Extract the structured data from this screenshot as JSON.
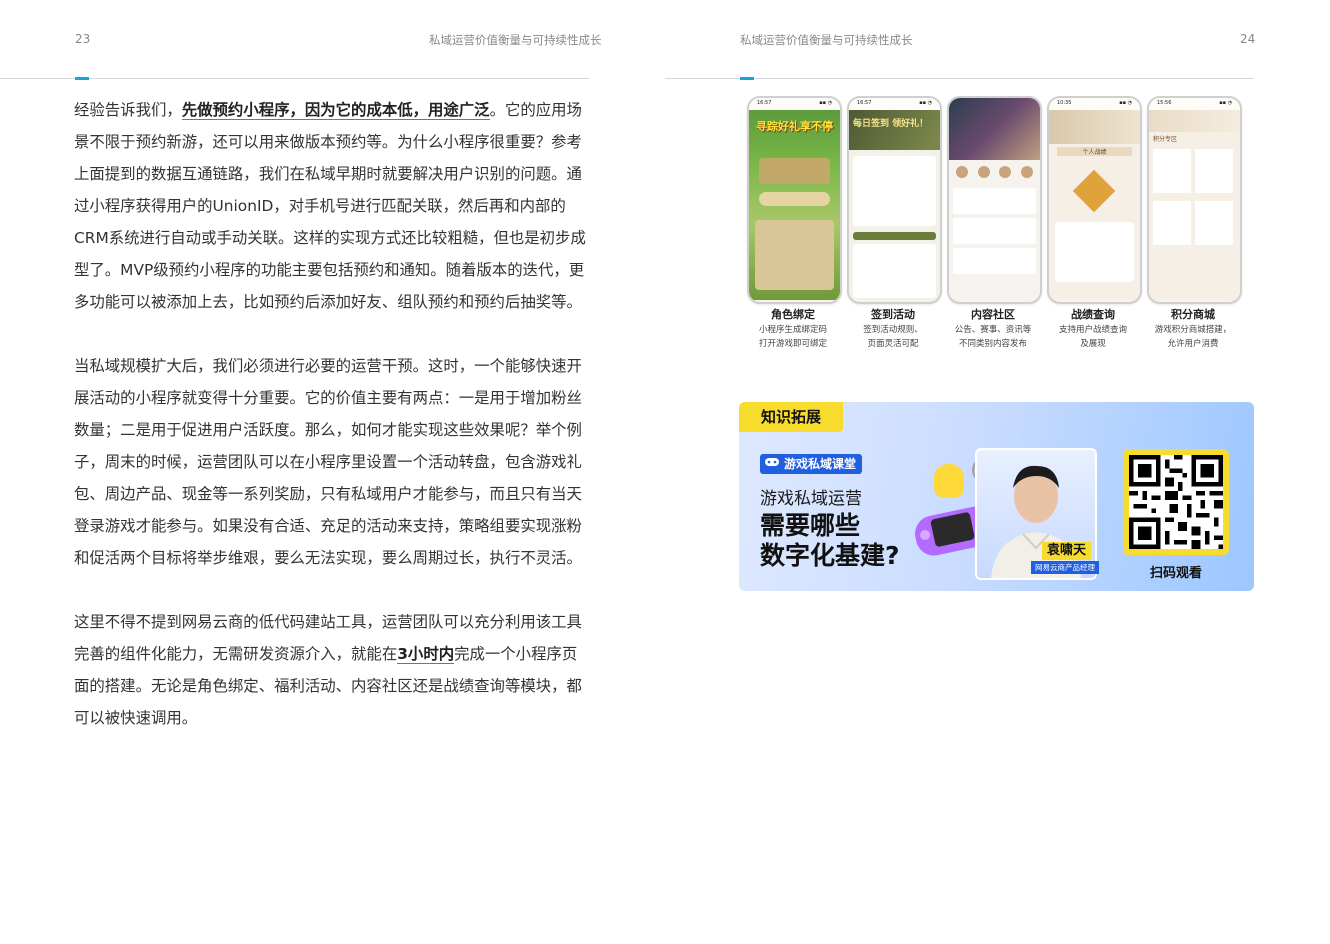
{
  "left_page": {
    "page_number": "23",
    "running_title": "私域运营价值衡量与可持续性成长",
    "para1": {
      "pre": "经验告诉我们，",
      "highlight": "先做预约小程序，因为它的成本低，用途广泛",
      "post": "。它的应用场景不限于预约新游，还可以用来做版本预约等。为什么小程序很重要？参考上面提到的数据互通链路，我们在私域早期时就要解决用户识别的问题。通过小程序获得用户的UnionID，对手机号进行匹配关联，然后再和内部的CRM系统进行自动或手动关联。这样的实现方式还比较粗糙，但也是初步成型了。MVP级预约小程序的功能主要包括预约和通知。随着版本的迭代，更多功能可以被添加上去，比如预约后添加好友、组队预约和预约后抽奖等。"
    },
    "para2": "当私域规模扩大后，我们必须进行必要的运营干预。这时，一个能够快速开展活动的小程序就变得十分重要。它的价值主要有两点：一是用于增加粉丝数量；二是用于促进用户活跃度。那么，如何才能实现这些效果呢？举个例子，周末的时候，运营团队可以在小程序里设置一个活动转盘，包含游戏礼包、周边产品、现金等一系列奖励，只有私域用户才能参与，而且只有当天登录游戏才能参与。如果没有合适、充足的活动来支持，策略组要实现涨粉和促活两个目标将举步维艰，要么无法实现，要么周期过长，执行不灵活。",
    "para3": {
      "pre": "这里不得不提到网易云商的低代码建站工具，运营团队可以充分利用该工具完善的组件化能力，无需研发资源介入，就能在",
      "highlight": "3小时内",
      "post": "完成一个小程序页面的搭建。无论是角色绑定、福利活动、内容社区还是战绩查询等模块，都可以被快速调用。"
    }
  },
  "right_page": {
    "page_number": "24",
    "running_title": "私域运营价值衡量与可持续性成长",
    "phones": [
      {
        "title": "角色绑定",
        "desc1": "小程序生成绑定码",
        "desc2": "打开游戏即可绑定",
        "screen_text": "寻踪好礼享不停",
        "time": "16:57"
      },
      {
        "title": "签到活动",
        "desc1": "签到活动规则、",
        "desc2": "页面灵活可配",
        "screen_text": "每日签到 领好礼！",
        "time": "16:57"
      },
      {
        "title": "内容社区",
        "desc1": "公告、赛事、资讯等",
        "desc2": "不同类别内容发布",
        "screen_text": "",
        "time": "10:35"
      },
      {
        "title": "战绩查询",
        "desc1": "支持用户战绩查询",
        "desc2": "及展现",
        "screen_text": "个人战绩",
        "time": "10:35"
      },
      {
        "title": "积分商城",
        "desc1": "游戏积分商城搭建，",
        "desc2": "允许用户消费",
        "screen_text": "积分专区",
        "time": "15:56"
      }
    ],
    "banner": {
      "tag": "知识拓展",
      "badge": "游戏私域课堂",
      "line1": "游戏私域运营",
      "line2": "需要哪些",
      "line3": "数字化基建?",
      "person_name": "袁啸天",
      "person_role": "网易云商产品经理",
      "qr_label": "扫码观看"
    }
  },
  "colors": {
    "accent_blue": "#14a6d8",
    "tag_yellow": "#f7dc2e",
    "badge_blue": "#1f5fe0"
  }
}
